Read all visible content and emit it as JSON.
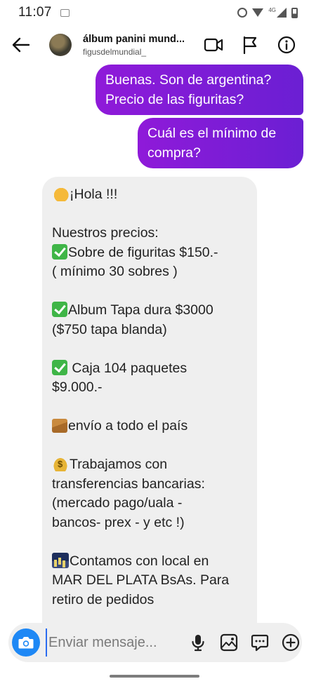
{
  "status_bar": {
    "time": "11:07",
    "network": "4G"
  },
  "header": {
    "title": "álbum panini mund...",
    "username": "figusdelmundial_",
    "icons": [
      "back-arrow-icon",
      "video-call-icon",
      "flag-icon",
      "info-icon"
    ]
  },
  "messages": {
    "sent": [
      {
        "lines": [
          "Buenas. Son de argentina?",
          "Precio de las figuritas?"
        ]
      },
      {
        "lines": [
          "Cuál es el mínimo de",
          "compra?"
        ]
      }
    ],
    "received": {
      "lines": [
        "¡Hola !!!",
        "",
        "Nuestros precios:",
        "Sobre de figuritas $150.-",
        "( mínimo 30 sobres )",
        "",
        "Album Tapa dura $3000",
        "($750 tapa blanda)",
        "",
        " Caja 104 paquetes",
        "$9.000.-",
        "",
        "envío a todo el país",
        "",
        "Trabajamos con",
        "transferencias bancarias:",
        "(mercado pago/uala -",
        "bancos- prex - y etc !)",
        "",
        "Contamos con local en",
        "MAR DEL PLATA BsAs. Para",
        "retiro de pedidos"
      ]
    }
  },
  "composer": {
    "placeholder": "Enviar mensaje...",
    "value": ""
  },
  "colors": {
    "sent_bubble_start": "#8f1ad9",
    "sent_bubble_end": "#6b1fd3",
    "received_bubble": "#efefef",
    "camera_button": "#1e88f5"
  }
}
